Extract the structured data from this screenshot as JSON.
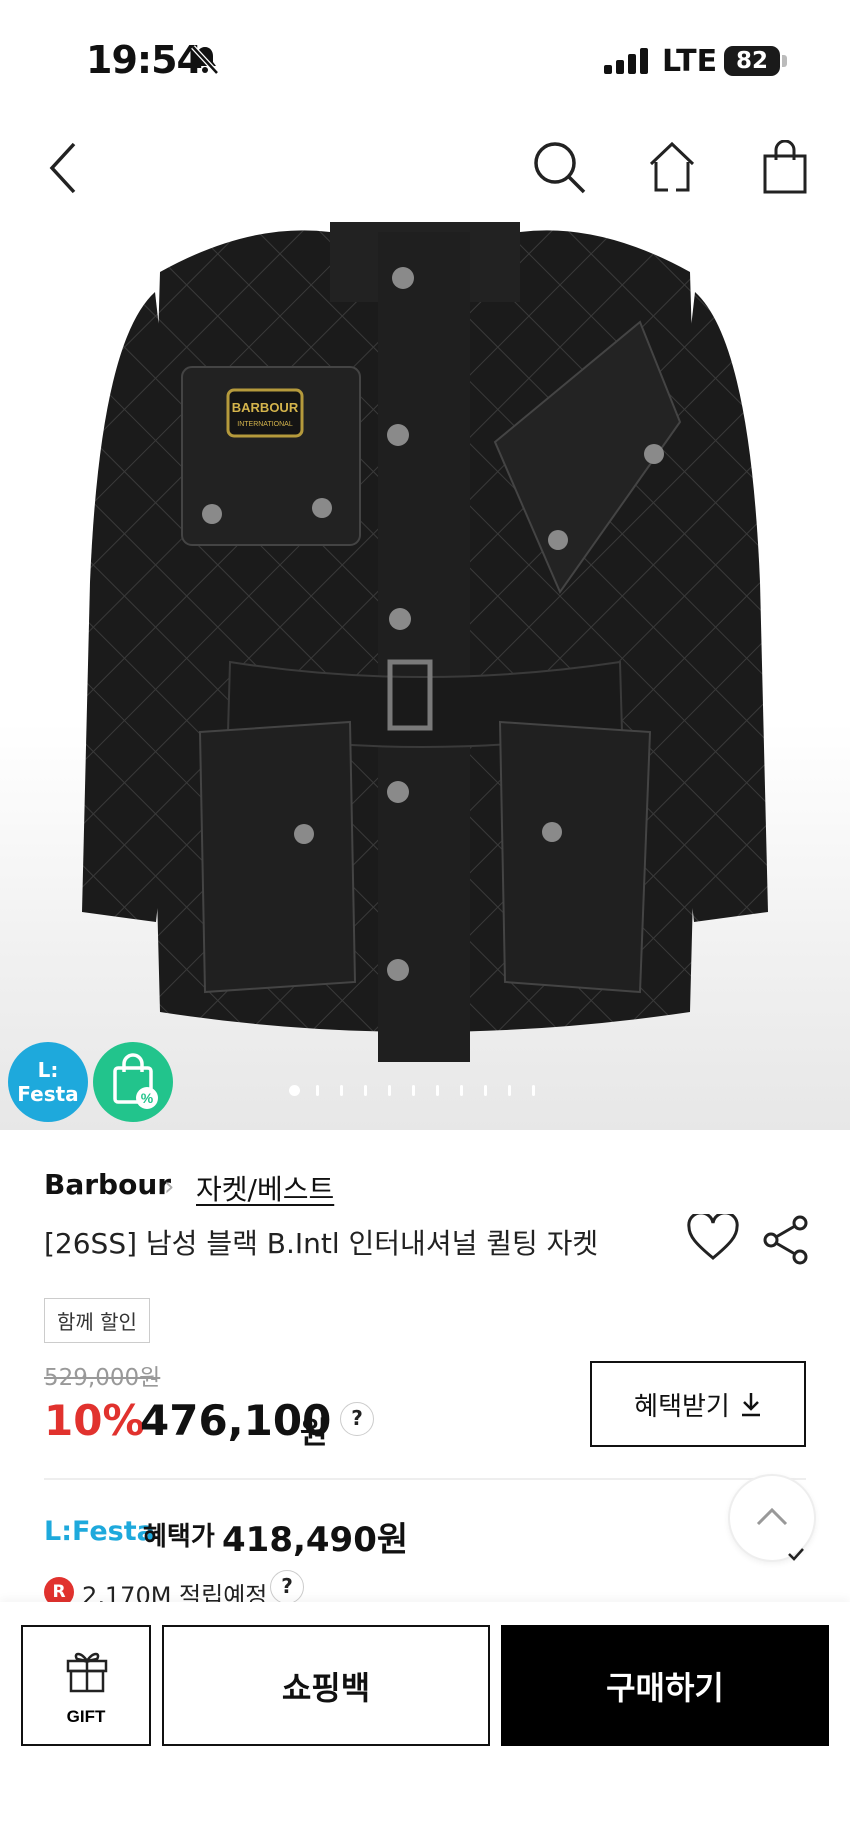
{
  "status_bar": {
    "time": "19:54",
    "network": "LTE",
    "battery": "82"
  },
  "header": {
    "back_icon": "chevron-left-icon",
    "search_icon": "search-icon",
    "home_icon": "home-icon",
    "cart_icon": "shopping-bag-icon"
  },
  "hero": {
    "badge_festa": {
      "line1": "L:",
      "line2": "Festa",
      "color": "#1ea9dc"
    },
    "badge_discount_icon": "discount-bag-icon",
    "badge_discount_color": "#22c48c",
    "image_dots": {
      "total": 12,
      "active_index": 0
    }
  },
  "product": {
    "brand": "Barbour",
    "category": "자켓/베스트",
    "title": "[26SS] 남성 블랙 B.Intl 인터내셔널 퀼팅 자켓",
    "tag": "함께 할인",
    "original_price": "529,000원",
    "discount_rate": "10%",
    "price": "476,100",
    "price_unit": "원",
    "help_mark": "?",
    "benefit_button": "혜택받기"
  },
  "festa": {
    "brand": "L:Festa",
    "label": "혜택가",
    "price": "418,490원"
  },
  "points": {
    "badge": "R",
    "text": "2,170M 적립예정",
    "help_mark": "?"
  },
  "bottom_bar": {
    "gift_label": "GIFT",
    "bag_label": "쇼핑백",
    "buy_label": "구매하기"
  },
  "colors": {
    "sale_red": "#e1322e",
    "festa_blue": "#1ea9dc",
    "buy_black": "#000000"
  }
}
